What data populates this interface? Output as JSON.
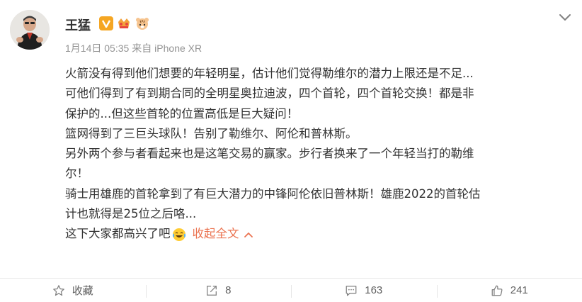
{
  "post": {
    "author": "王猛",
    "date": "1月14日 05:35",
    "source": "来自 iPhone XR",
    "content_lines": [
      "火箭没有得到他们想要的年轻明星，估计他们觉得勒维尔的潜力上限还是不足...",
      "可他们得到了有到期合同的全明星奥拉迪波，四个首轮，四个首轮交换！都是非",
      "保护的...但这些首轮的位置高低是巨大疑问！",
      "篮网得到了三巨头球队！告别了勒维尔、阿伦和普林斯。",
      "另外两个参与者看起来也是这笔交易的赢家。步行者换来了一个年轻当打的勒维",
      "尔！",
      "骑士用雄鹿的首轮拿到了有巨大潜力的中锋阿伦依旧普林斯！雄鹿2022的首轮估",
      "计也就得是25位之后咯..."
    ],
    "last_line": "这下大家都高兴了吧",
    "emoji": "laughing-tears-emoji",
    "collapse_label": "收起全文"
  },
  "actions": {
    "favorite_label": "收藏",
    "repost_count": "8",
    "comment_count": "163",
    "like_count": "241"
  },
  "colors": {
    "link": "#eb7350",
    "meta": "#939393",
    "text": "#333333",
    "badge_v": "#f5a623"
  }
}
